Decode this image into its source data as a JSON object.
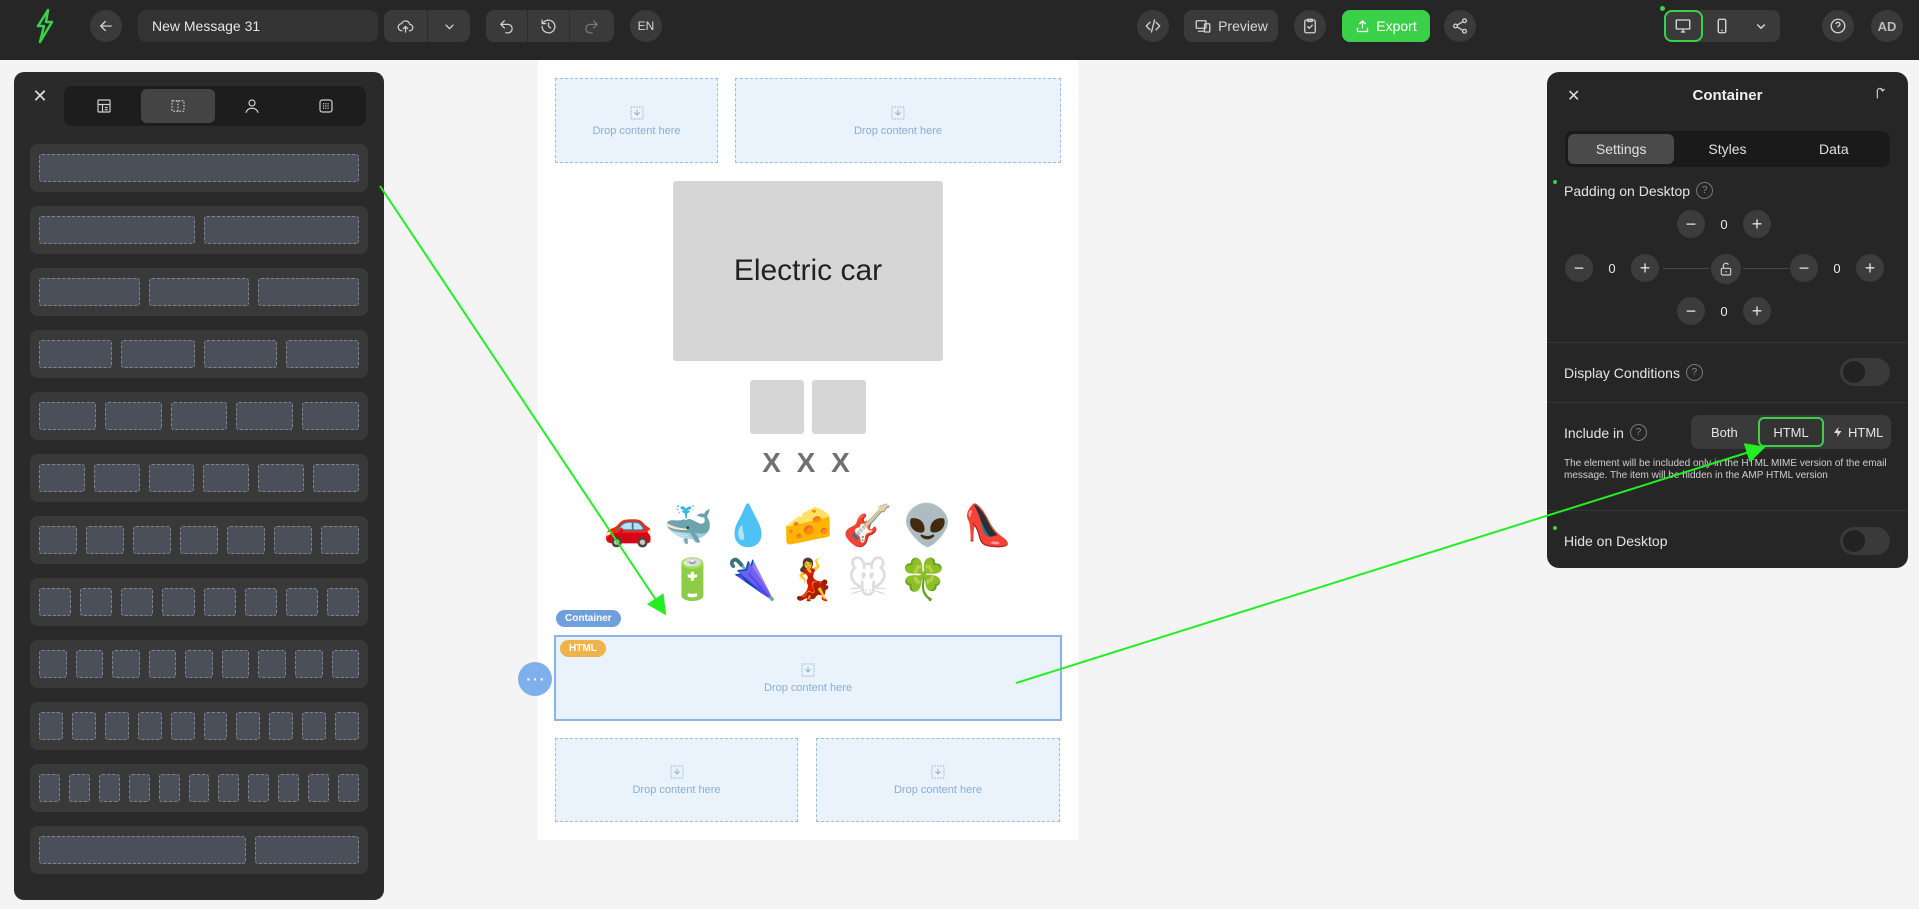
{
  "topbar": {
    "message_title": "New Message 31",
    "language": "EN",
    "preview_label": "Preview",
    "export_label": "Export",
    "avatar_initials": "AD",
    "accent_color": "#3bd04a"
  },
  "left_panel": {
    "close_glyph": "✕",
    "tabs": [
      "templates-icon",
      "layouts-icon",
      "person-icon",
      "modules-icon"
    ],
    "active_tab_index": 1,
    "layout_rows": [
      1,
      2,
      3,
      4,
      5,
      6,
      7,
      8,
      9,
      10,
      11,
      "1+small"
    ]
  },
  "canvas": {
    "drop_label": "Drop content here",
    "hero_text": "Electric car",
    "xxx_text": "X X X",
    "emoji_row_1": [
      "🚗",
      "🐳",
      "💧",
      "🧀",
      "🎸",
      "👽",
      "👠"
    ],
    "emoji_row_2": [
      "🔋",
      "🌂",
      "💃",
      "🐭",
      "🍀"
    ],
    "container_badge": "Container",
    "html_badge": "HTML",
    "more_glyph": "···"
  },
  "right_panel": {
    "title": "Container",
    "tabs": [
      "Settings",
      "Styles",
      "Data"
    ],
    "active_tab": "Settings",
    "padding_label": "Padding on Desktop",
    "padding": {
      "top": "0",
      "left": "0",
      "right": "0",
      "bottom": "0"
    },
    "display_conditions_label": "Display Conditions",
    "display_conditions_on": false,
    "include_in_label": "Include in",
    "include_options": [
      "Both",
      "HTML",
      "HTML"
    ],
    "include_selected": "HTML",
    "include_note": "The element will be included only in the HTML MIME version of the email message. The item will be hidden in the AMP HTML version",
    "hide_on_desktop_label": "Hide on Desktop",
    "hide_on_desktop_on": false,
    "question_glyph": "?"
  },
  "annotations": {
    "arrow_color": "#22ee22"
  }
}
